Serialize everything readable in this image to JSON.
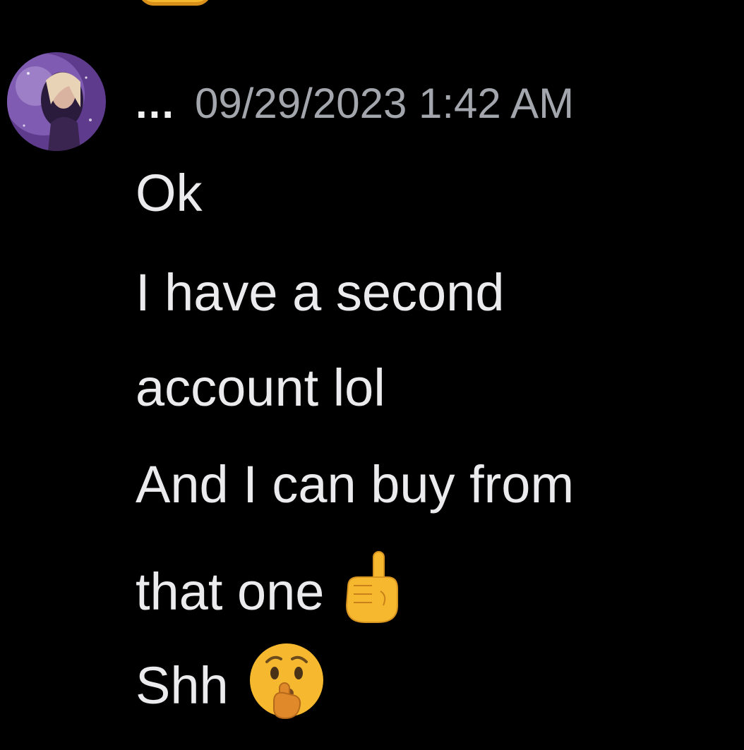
{
  "message": {
    "author": {
      "name": "...",
      "avatar_icon": "profile-avatar-icon"
    },
    "timestamp": "09/29/2023 1:42 AM",
    "lines": [
      {
        "text": "Ok"
      },
      {
        "text": "I have a second"
      },
      {
        "text": "account lol"
      },
      {
        "text": "And I can buy from"
      },
      {
        "text": "that one",
        "emoji_icon": "index-pointing-up-icon"
      },
      {
        "text": "Shh",
        "emoji_icon": "shushing-face-icon"
      }
    ]
  },
  "colors": {
    "background": "#000000",
    "message_text": "#ebebed",
    "timestamp_text": "#a3a6ad",
    "emoji_yellow": "#f5b82e"
  }
}
